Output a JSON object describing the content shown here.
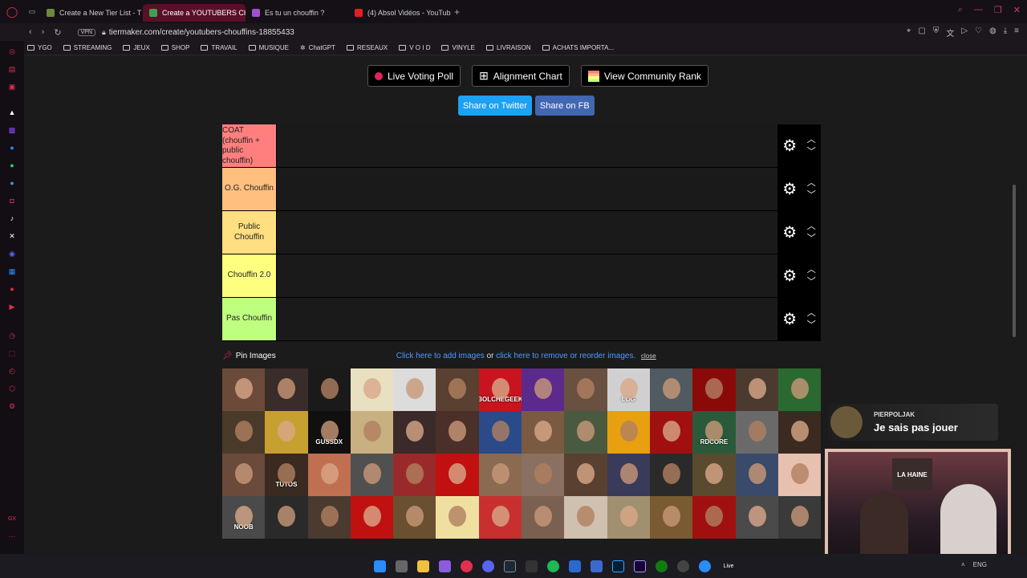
{
  "tabs": [
    {
      "label": "Create a New Tier List - T",
      "color": "#6d8a3a",
      "active": false
    },
    {
      "label": "Create a YOUTUBERS CH",
      "color": "#3fa14f",
      "active": true
    },
    {
      "label": "Es tu un chouffin ?",
      "color": "#a050d0",
      "active": false
    },
    {
      "label": "(4) Absol Vidéos - YouTub",
      "color": "#e02020",
      "active": false
    }
  ],
  "address": {
    "vpn": "VPN",
    "url": "tiermaker.com/create/youtubers-chouffins-18855433"
  },
  "bookmarks": [
    "YGO",
    "STREAMING",
    "JEUX",
    "SHOP",
    "TRAVAIL",
    "MUSIQUE",
    "ChatGPT",
    "RESEAUX",
    "V O I D",
    "VINYLE",
    "LIVRAISON",
    "ACHATS IMPORTA..."
  ],
  "buttons": {
    "live_poll": "Live Voting Poll",
    "alignment": "Alignment Chart",
    "community": "View Community Rank",
    "twitter": "Share on Twitter",
    "fb": "Share on FB"
  },
  "colors": {
    "twitter": "#1da1f2",
    "fb": "#4267b2"
  },
  "tiers": [
    {
      "label": "COAT (chouffin + public chouffin)",
      "color": "#ff7f7f"
    },
    {
      "label": "O.G. Chouffin",
      "color": "#ffbf7f"
    },
    {
      "label": "Public Chouffin",
      "color": "#ffdf7f"
    },
    {
      "label": "Chouffin 2.0",
      "color": "#ffff7f"
    },
    {
      "label": "Pas Chouffin",
      "color": "#bfff7f"
    }
  ],
  "pin": {
    "label": "Pin Images",
    "add_link": "Click here to add images",
    "or": "or",
    "remove_link": "click here to remove or reorder images.",
    "close": "close"
  },
  "image_labels": {
    "bolchegeek": "BOLCHEGEEK",
    "log": "LOG",
    "tutos": "TUTOS",
    "noob": "NOOB",
    "hadcore": "RDCORE",
    "ghost": "GUSSDX"
  },
  "chat": {
    "name": "PIERPOLJAK",
    "message": "Je sais pas jouer"
  },
  "cam": {
    "sign": "LA HAINE"
  },
  "tray": {
    "lang": "ENG",
    "live": "Live"
  }
}
